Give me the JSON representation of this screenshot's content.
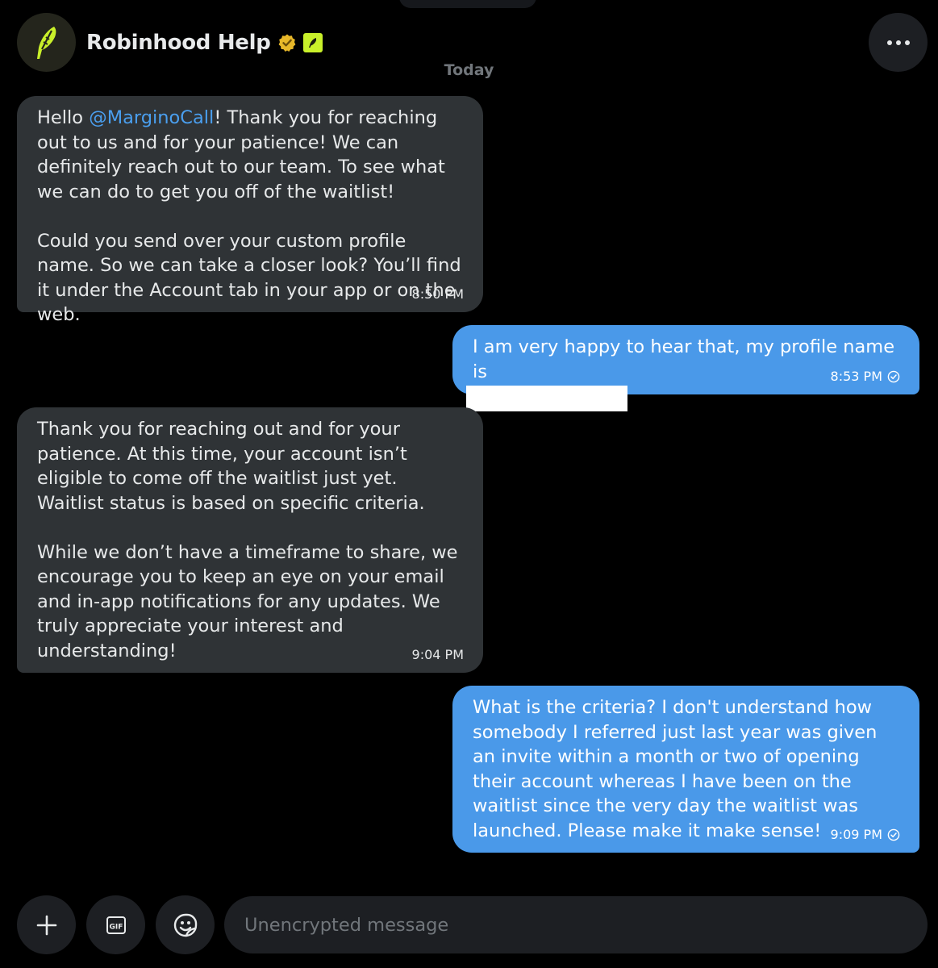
{
  "header": {
    "title": "Robinhood Help",
    "verified_icon": "verified-badge-icon",
    "affiliate_icon": "robinhood-feather-icon",
    "more_icon": "more-horizontal-icon",
    "brand_color": "#c9f02a"
  },
  "date_separator": "Today",
  "messages": [
    {
      "direction": "incoming",
      "paragraphs": [
        {
          "prefix": "Hello ",
          "mention": "@MarginoCall",
          "suffix": "! Thank you for reaching out to us and for your patience! We can definitely reach out to our team. To see what we can do to get you off of the waitlist!"
        },
        {
          "text": "Could you send over your custom profile name. So we can take a closer look? You’ll find it under the Account tab in your app or on the web."
        }
      ],
      "time": "8:50 PM"
    },
    {
      "direction": "outgoing",
      "text": "I am very happy to hear that, my profile name is",
      "redacted": true,
      "time": "8:53 PM",
      "status_icon": "sent-check-icon"
    },
    {
      "direction": "incoming",
      "paragraphs": [
        {
          "text": "Thank you for reaching out and for your patience. At this time, your account isn’t eligible to come off the waitlist just yet. Waitlist status is based on specific criteria."
        },
        {
          "text": "While we don’t have a timeframe to share, we encourage you to keep an eye on your email and in-app notifications for any updates. We truly appreciate your interest and understanding!"
        }
      ],
      "time": "9:04 PM"
    },
    {
      "direction": "outgoing",
      "text": "What is the criteria? I don't understand how somebody I referred just last year was given an invite within a month or two of opening their account whereas I have been on the waitlist since the very day the waitlist was launched. Please make it make sense!",
      "time": "9:09 PM",
      "status_icon": "sent-check-icon"
    }
  ],
  "composer": {
    "add_icon": "plus-icon",
    "gif_icon": "gif-icon",
    "emoji_icon": "emoji-icon",
    "placeholder": "Unencrypted message",
    "value": ""
  },
  "colors": {
    "background": "#000000",
    "incoming_bubble": "#2f3336",
    "outgoing_bubble": "#4a99e9",
    "mention": "#4a9fef",
    "muted_text": "#71767b"
  }
}
